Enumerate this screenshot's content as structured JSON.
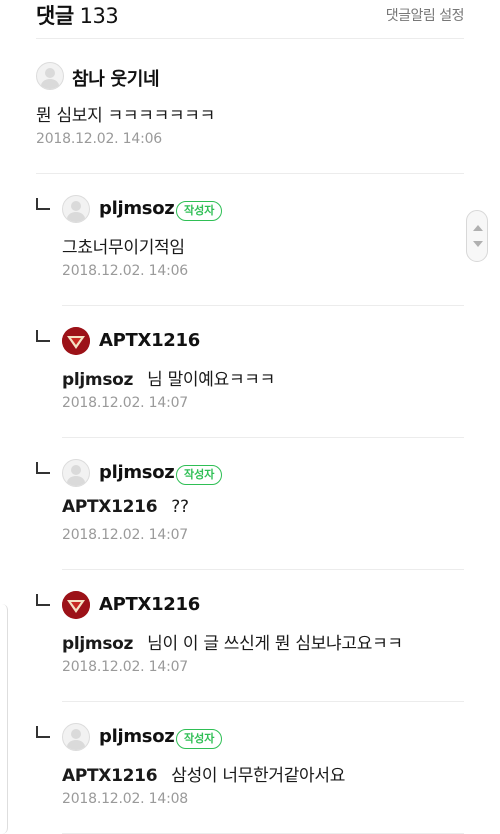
{
  "header": {
    "title": "댓글",
    "count": "133",
    "notify_setting": "댓글알림 설정"
  },
  "comments": [
    {
      "nickname": "참나 웃기네",
      "author_badge": "",
      "mention": "",
      "text": "뭔 심보지 ㅋㅋㅋㅋㅋㅋㅋ",
      "date": "2018.12.02. 14:06",
      "is_reply": false,
      "avatar": "default-avatar"
    },
    {
      "nickname": "pljmsoz",
      "author_badge": "작성자",
      "mention": "",
      "text": "그쵸너무이기적임",
      "date": "2018.12.02. 14:06",
      "is_reply": true,
      "avatar": "default-avatar"
    },
    {
      "nickname": "APTX1216",
      "author_badge": "",
      "mention": "pljmsoz",
      "text": "님 말이예요ㅋㅋㅋ",
      "date": "2018.12.02. 14:07",
      "is_reply": true,
      "avatar": "red-emblem-avatar"
    },
    {
      "nickname": "pljmsoz",
      "author_badge": "작성자",
      "mention": "APTX1216",
      "text": "??",
      "date": "2018.12.02. 14:07",
      "is_reply": true,
      "avatar": "default-avatar"
    },
    {
      "nickname": "APTX1216",
      "author_badge": "",
      "mention": "pljmsoz",
      "text": "님이 이 글 쓰신게 뭔 심보냐고요ㅋㅋ",
      "date": "2018.12.02. 14:07",
      "is_reply": true,
      "avatar": "red-emblem-avatar"
    },
    {
      "nickname": "pljmsoz",
      "author_badge": "작성자",
      "mention": "APTX1216",
      "text": "삼성이 너무한거같아서요",
      "date": "2018.12.02. 14:08",
      "is_reply": true,
      "avatar": "default-avatar"
    }
  ],
  "colors": {
    "badge_green": "#2fbf55",
    "avatar_red": "#9c1218",
    "date_gray": "#9a9a9a",
    "divider": "#ececec"
  }
}
